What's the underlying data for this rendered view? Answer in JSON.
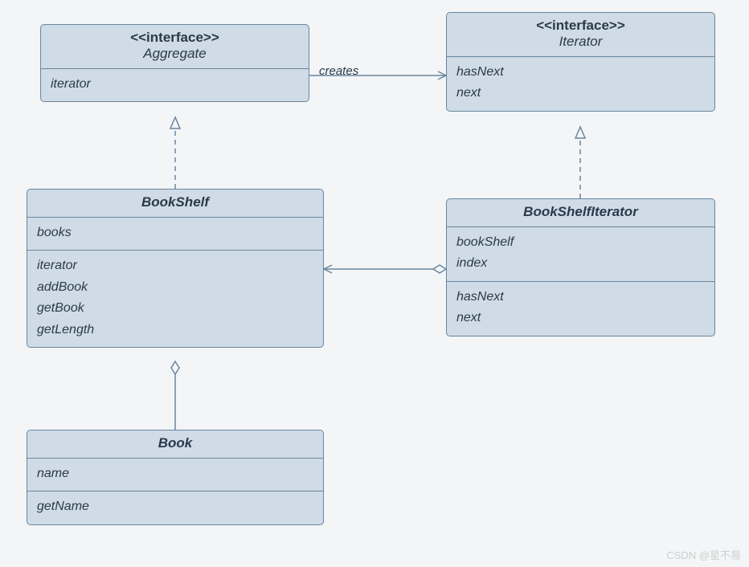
{
  "boxes": {
    "aggregate": {
      "stereotype": "<<interface>>",
      "name": "Aggregate",
      "attrs": [
        "iterator"
      ]
    },
    "iterator": {
      "stereotype": "<<interface>>",
      "name": "Iterator",
      "attrs": [
        "hasNext",
        "next"
      ]
    },
    "bookshelf": {
      "name": "BookShelf",
      "attrs": [
        "books"
      ],
      "ops": [
        "iterator",
        "addBook",
        "getBook",
        "getLength"
      ]
    },
    "bookshelfIterator": {
      "name": "BookShelfIterator",
      "attrs": [
        "bookShelf",
        "index"
      ],
      "ops": [
        "hasNext",
        "next"
      ]
    },
    "book": {
      "name": "Book",
      "attrs": [
        "name"
      ],
      "ops": [
        "getName"
      ]
    }
  },
  "edges": {
    "creates_label": "creates"
  },
  "watermark": "CSDN @星不易"
}
